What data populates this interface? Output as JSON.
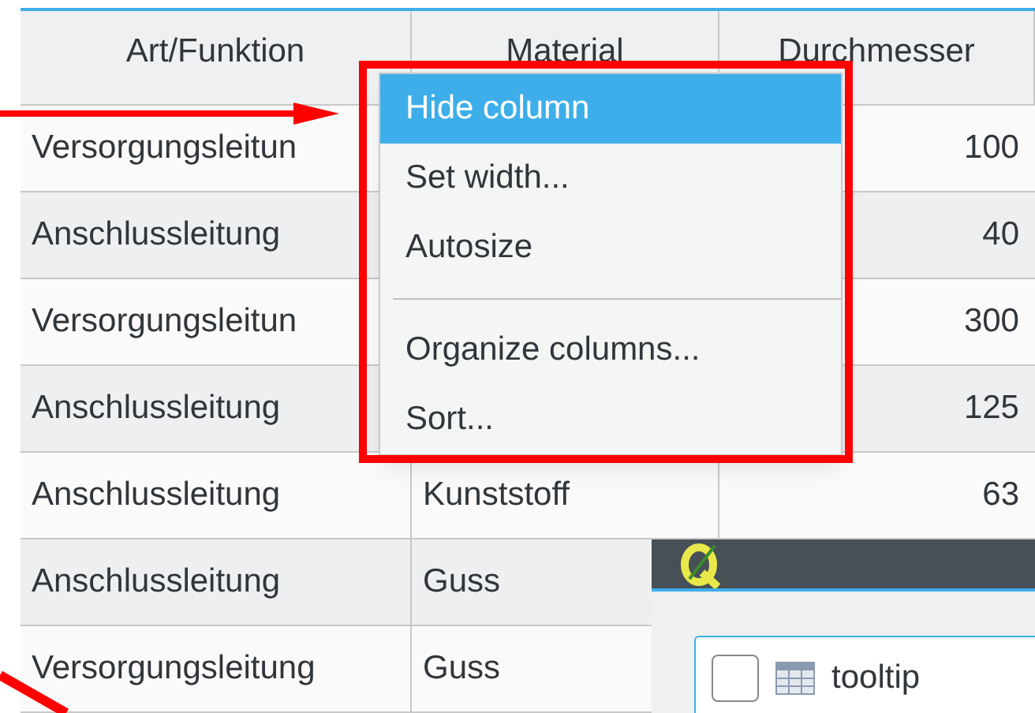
{
  "table": {
    "columns": [
      "Art/Funktion",
      "Material",
      "Durchmesser"
    ],
    "rows": [
      {
        "art": "Versorgungsleitun",
        "durchmesser": "100"
      },
      {
        "art": "Anschlussleitung",
        "durchmesser": "40"
      },
      {
        "art": "Versorgungsleitun",
        "durchmesser": "300"
      },
      {
        "art": "Anschlussleitung",
        "durchmesser": "125"
      },
      {
        "art": "Anschlussleitung",
        "material": "Kunststoff",
        "durchmesser": "63"
      },
      {
        "art": "Anschlussleitung",
        "material": "Guss"
      },
      {
        "art": "Versorgungsleitung",
        "material": "Guss"
      }
    ]
  },
  "context_menu": {
    "items": [
      {
        "kind": "item",
        "label": "Hide column",
        "selected": true
      },
      {
        "kind": "item",
        "label": "Set width...",
        "selected": false
      },
      {
        "kind": "item",
        "label": "Autosize",
        "selected": false
      },
      {
        "kind": "separator"
      },
      {
        "kind": "item",
        "label": "Organize columns...",
        "selected": false
      },
      {
        "kind": "item",
        "label": "Sort...",
        "selected": false
      }
    ]
  },
  "dialog": {
    "list": [
      {
        "label": "tooltip",
        "checked": false
      }
    ]
  }
}
